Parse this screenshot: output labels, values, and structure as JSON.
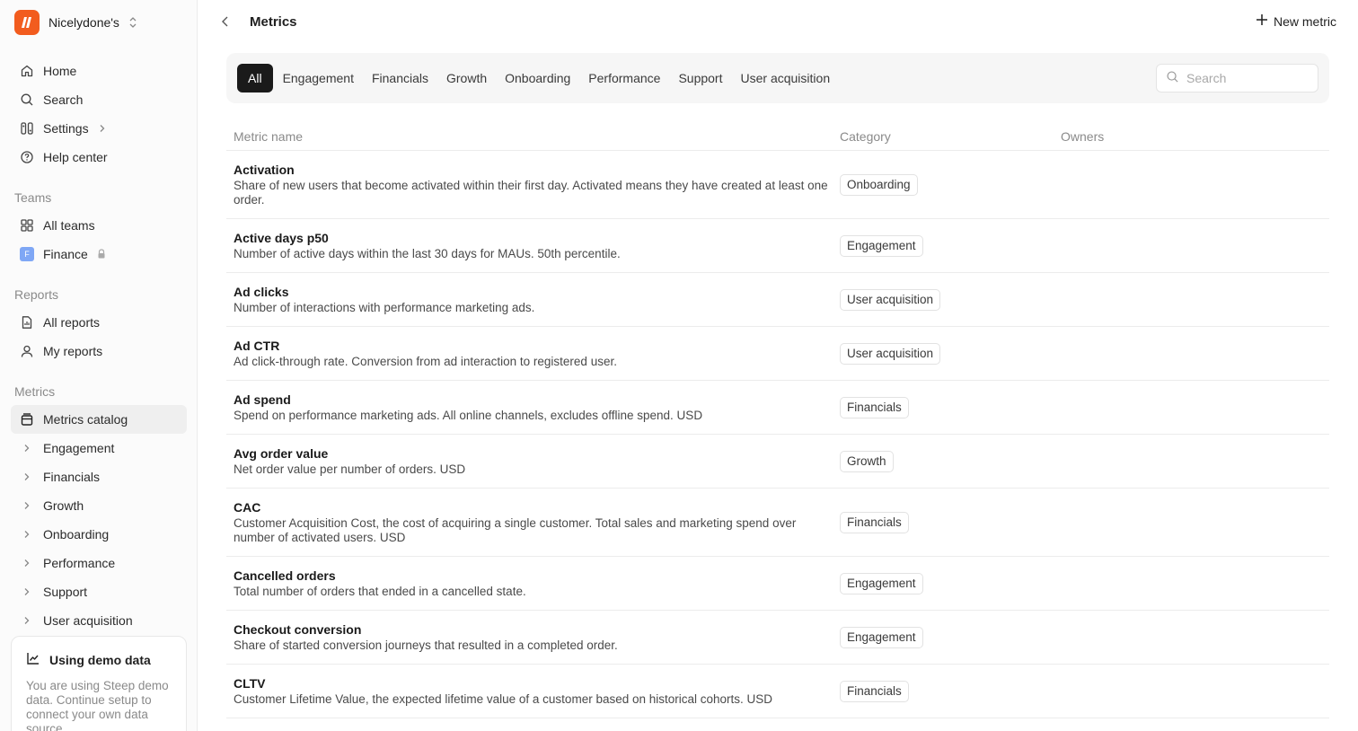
{
  "workspace": {
    "name": "Nicelydone's"
  },
  "nav": {
    "primary": [
      {
        "label": "Home",
        "icon": "home-icon"
      },
      {
        "label": "Search",
        "icon": "search-icon"
      },
      {
        "label": "Settings",
        "icon": "settings-icon"
      },
      {
        "label": "Help center",
        "icon": "help-icon"
      }
    ],
    "teams_label": "Teams",
    "teams": [
      {
        "label": "All teams"
      },
      {
        "label": "Finance",
        "badge": "F"
      }
    ],
    "reports_label": "Reports",
    "reports": [
      {
        "label": "All reports"
      },
      {
        "label": "My reports"
      }
    ],
    "metrics_label": "Metrics",
    "metrics": [
      {
        "label": "Metrics catalog"
      },
      {
        "label": "Engagement"
      },
      {
        "label": "Financials"
      },
      {
        "label": "Growth"
      },
      {
        "label": "Onboarding"
      },
      {
        "label": "Performance"
      },
      {
        "label": "Support"
      },
      {
        "label": "User acquisition"
      }
    ]
  },
  "demo": {
    "title": "Using demo data",
    "text": "You are using Steep demo data. Continue setup to connect your own data source."
  },
  "header": {
    "title": "Metrics",
    "new_label": "New metric"
  },
  "filters": {
    "tabs": [
      "All",
      "Engagement",
      "Financials",
      "Growth",
      "Onboarding",
      "Performance",
      "Support",
      "User acquisition"
    ],
    "active": "All",
    "search_placeholder": "Search"
  },
  "table": {
    "columns": [
      "Metric name",
      "Category",
      "Owners"
    ],
    "rows": [
      {
        "name": "Activation",
        "desc": "Share of new users that become activated within their first day. Activated means they have created at least one order.",
        "category": "Onboarding"
      },
      {
        "name": "Active days p50",
        "desc": "Number of active days within the last 30 days for MAUs. 50th percentile.",
        "category": "Engagement"
      },
      {
        "name": "Ad clicks",
        "desc": "Number of interactions with performance marketing ads.",
        "category": "User acquisition"
      },
      {
        "name": "Ad CTR",
        "desc": "Ad click-through rate. Conversion from ad interaction to registered user.",
        "category": "User acquisition"
      },
      {
        "name": "Ad spend",
        "desc": "Spend on performance marketing ads. All online channels, excludes offline spend. USD",
        "category": "Financials"
      },
      {
        "name": "Avg order value",
        "desc": "Net order value per number of orders. USD",
        "category": "Growth"
      },
      {
        "name": "CAC",
        "desc": "Customer Acquisition Cost, the cost of acquiring a single customer. Total sales and marketing spend over number of activated users. USD",
        "category": "Financials"
      },
      {
        "name": "Cancelled orders",
        "desc": "Total number of orders that ended in a cancelled state.",
        "category": "Engagement"
      },
      {
        "name": "Checkout conversion",
        "desc": "Share of started conversion journeys that resulted in a completed order.",
        "category": "Engagement"
      },
      {
        "name": "CLTV",
        "desc": "Customer Lifetime Value, the expected lifetime value of a customer based on historical cohorts. USD",
        "category": "Financials"
      }
    ]
  },
  "colors": {
    "brand": "#f25c1e",
    "active_tab": "#1a1a1a",
    "team_badge": "#7fa7f5"
  }
}
